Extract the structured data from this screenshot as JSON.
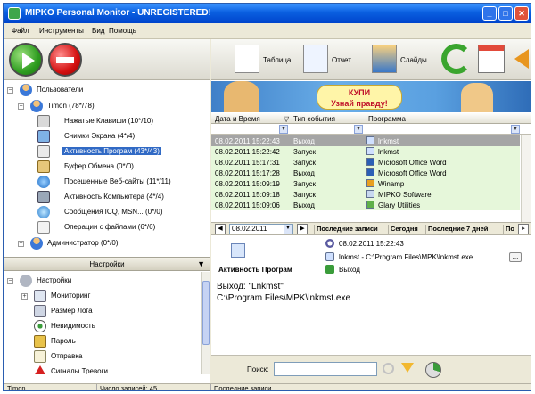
{
  "window": {
    "title": "MIPKO Personal Monitor - UNREGISTERED!"
  },
  "menu": [
    "Файл",
    "Инструменты",
    "Вид",
    "Помощь"
  ],
  "toolbar": {
    "table_label": "Таблица",
    "report_label": "Отчет",
    "slides_label": "Слайды"
  },
  "tree": {
    "users_label": "Пользователи",
    "timon_label": "Timon (78*/78)",
    "items": [
      "Нажатые Клавиши (10*/10)",
      "Снимки Экрана (4*/4)",
      "Активность Програм (43*/43)",
      "Буфер Обмена (0*/0)",
      "Посещенные Веб-сайты (11*/11)",
      "Активность Компьютера (4*/4)",
      "Сообщения ICQ, MSN... (0*/0)",
      "Операции с файлами (6*/6)"
    ],
    "admin_label": "Администратор (0*/0)"
  },
  "settings": {
    "header": "Настройки",
    "root_label": "Настройки",
    "items": [
      "Мониторинг",
      "Размер Лога",
      "Невидимость",
      "Пароль",
      "Отправка",
      "Сигналы Тревоги"
    ]
  },
  "banner": {
    "line1": "КУПИ",
    "line2": "Узнай правду!"
  },
  "grid": {
    "columns": [
      "Дата и Время",
      "Тип события",
      "Программа"
    ],
    "rows": [
      {
        "datetime": "08.02.2011 15:22:43",
        "type": "Выход",
        "program": "lnkmst"
      },
      {
        "datetime": "08.02.2011 15:22:42",
        "type": "Запуск",
        "program": "lnkmst"
      },
      {
        "datetime": "08.02.2011 15:17:31",
        "type": "Запуск",
        "program": "Microsoft Office Word"
      },
      {
        "datetime": "08.02.2011 15:17:28",
        "type": "Выход",
        "program": "Microsoft Office Word"
      },
      {
        "datetime": "08.02.2011 15:09:19",
        "type": "Запуск",
        "program": "Winamp"
      },
      {
        "datetime": "08.02.2011 15:09:18",
        "type": "Запуск",
        "program": "MIPKO Software"
      },
      {
        "datetime": "08.02.2011 15:09:06",
        "type": "Выход",
        "program": "Glary Utilities"
      }
    ]
  },
  "datebar": {
    "date": "08.02.2011",
    "tabs": [
      "Последние записи",
      "Сегодня",
      "Последние 7 дней",
      "По"
    ]
  },
  "detail": {
    "title": "Активность Програм",
    "timestamp": "08.02.2011 15:22:43",
    "path": "lnkmst - C:\\Program Files\\MPK\\lnkmst.exe",
    "event": "Выход",
    "more_label": "..."
  },
  "text": {
    "line1": "Выход: \"Lnkmst\"",
    "line2": "C:\\Program Files\\MPK\\lnkmst.exe"
  },
  "search": {
    "label": "Поиск:",
    "value": ""
  },
  "status": {
    "user": "Timon",
    "count": "Число записей: 45",
    "mode": "Последние записи"
  },
  "colors": {
    "title_bar": "#0a5fe0",
    "row_bg": "#e6f7da",
    "selection": "#316ac5"
  }
}
